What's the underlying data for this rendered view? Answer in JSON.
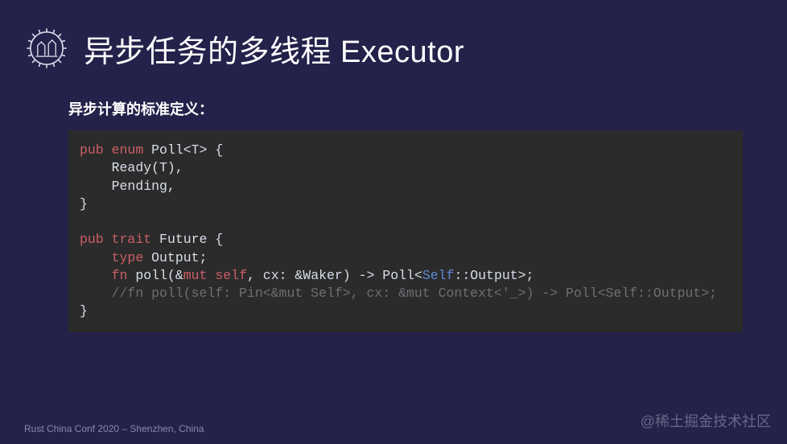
{
  "header": {
    "title": "异步任务的多线程 Executor"
  },
  "subtitle": "异步计算的标准定义：",
  "code": {
    "line1_pub": "pub",
    "line1_enum": "enum",
    "line1_name": "Poll",
    "line1_gen": "<T> {",
    "line2": "Ready(T),",
    "line3": "Pending,",
    "line4": "}",
    "line5": "",
    "line6_pub": "pub",
    "line6_trait": "trait",
    "line6_name": "Future {",
    "line7_type": "type",
    "line7_output": "Output",
    "line7_semi": ";",
    "line8_fn": "fn",
    "line8_name": "poll",
    "line8_sig1": "(&",
    "line8_mut": "mut",
    "line8_sig2": " ",
    "line8_self": "self",
    "line8_sig3": ", cx: &Waker) -> Poll<",
    "line8_selfty": "Self",
    "line8_sig4": "::Output>;",
    "line9_comment": "//fn poll(self: Pin<&mut Self>, cx: &mut Context<'_>) -> Poll<Self::Output>;",
    "line10": "}"
  },
  "footer": "Rust China Conf 2020 – Shenzhen, China",
  "watermark": "@稀土掘金技术社区"
}
